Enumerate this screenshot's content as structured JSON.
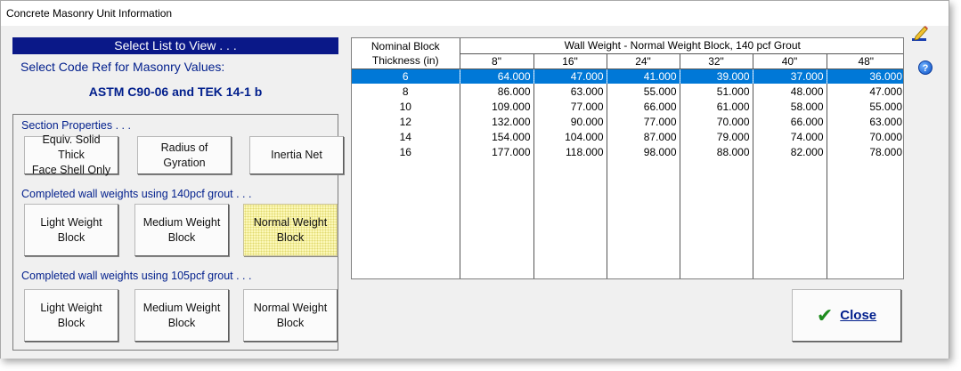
{
  "window": {
    "title": "Concrete Masonry Unit Information"
  },
  "left_panel": {
    "select_header": "Select List to View . . .",
    "code_ref_label": "Select Code Ref for Masonry Values:",
    "code_ref_value": "ASTM C90-06 and TEK 14-1 b",
    "section_properties": {
      "label": "Section Properties . . .",
      "buttons": [
        "Equiv. Solid Thick\nFace Shell Only",
        "Radius of\nGyration",
        "Inertia Net"
      ]
    },
    "grout_140": {
      "label": "Completed wall weights using 140pcf grout . . .",
      "buttons": [
        "Light Weight\nBlock",
        "Medium Weight\nBlock",
        "Normal Weight\nBlock"
      ],
      "active_index": 2
    },
    "grout_105": {
      "label": "Completed wall weights using 105pcf grout . . .",
      "buttons": [
        "Light Weight\nBlock",
        "Medium Weight\nBlock",
        "Normal Weight\nBlock"
      ]
    }
  },
  "grid": {
    "header1_left": "Nominal Block",
    "header1_title": "Wall Weight - Normal Weight Block,  140 pcf Grout",
    "header2_left": "Thickness  (in)",
    "columns": [
      "8\"",
      "16\"",
      "24\"",
      "32\"",
      "40\"",
      "48\""
    ],
    "rows": [
      {
        "thickness": "6",
        "values": [
          "64.000",
          "47.000",
          "41.000",
          "39.000",
          "37.000",
          "36.000"
        ]
      },
      {
        "thickness": "8",
        "values": [
          "86.000",
          "63.000",
          "55.000",
          "51.000",
          "48.000",
          "47.000"
        ]
      },
      {
        "thickness": "10",
        "values": [
          "109.000",
          "77.000",
          "66.000",
          "61.000",
          "58.000",
          "55.000"
        ]
      },
      {
        "thickness": "12",
        "values": [
          "132.000",
          "90.000",
          "77.000",
          "70.000",
          "66.000",
          "63.000"
        ]
      },
      {
        "thickness": "14",
        "values": [
          "154.000",
          "104.000",
          "87.000",
          "79.000",
          "74.000",
          "70.000"
        ]
      },
      {
        "thickness": "16",
        "values": [
          "177.000",
          "118.000",
          "98.000",
          "88.000",
          "82.000",
          "78.000"
        ]
      }
    ],
    "selected_row": 0,
    "selection_color": "#0078d7"
  },
  "close_button": {
    "label": "Close",
    "icon": "checkmark-icon"
  },
  "toolbar_icons": {
    "edit": "edit-pencil-icon",
    "help": "help-icon",
    "help_glyph": "?"
  }
}
